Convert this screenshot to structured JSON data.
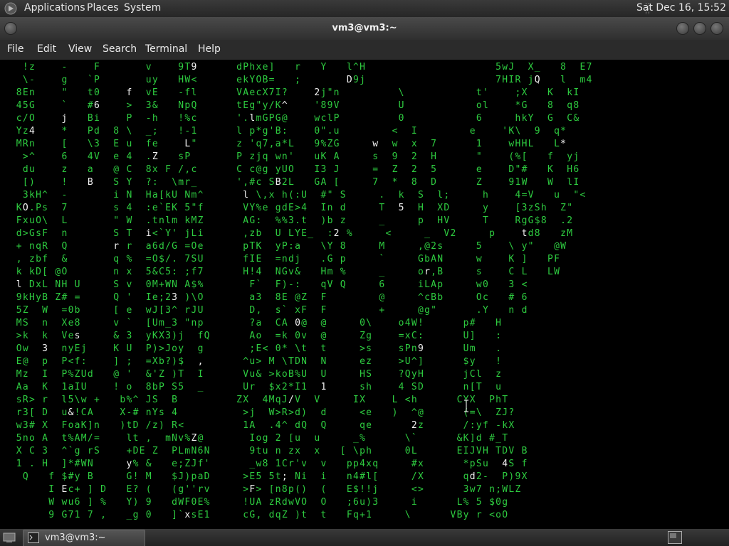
{
  "top_panel": {
    "menus": [
      "Applications",
      "Places",
      "System"
    ],
    "clock": "Sat Dec 16, 15:52"
  },
  "window": {
    "title": "vm3@vm3:~",
    "menu": [
      "File",
      "Edit",
      "View",
      "Search",
      "Terminal",
      "Help"
    ]
  },
  "taskbar": {
    "task_label": "vm3@vm3:~"
  },
  "terminal": {
    "rain_color": "#2ecc40",
    "bright_color": "#f2f2f2",
    "rows": [
      "   !z    -    F       v    9T9      dPhxe]   r   Y   l^H                    5wJ  X_   8  E7  ",
      "   \\-    g   `P       uy   HW<      ekYOB=   ;       D9j                    7HIR jQ   l  m4  ",
      "  8En    \"   t0    f  vE   -fl      VAecX7I?    2j\"n         \\           t'    ;X   K  kI  ",
      "  45G    `   #6    >  3&   NpQ      tEg\"y/K^    '89V         U           ol    *G   8  q8  ",
      "  c/O    j   Bi    P  -h   !%c      '.lmGPG@    wclP         0           6     hkY  G  C&  ",
      "  Yz4    *   Pd  8 \\  _;   !-1      l p*g'B:    0\".u        <  I        e    'K\\  9  q*  ",
      "  MRn    [   \\3  E u  fe    L\"      z 'q7,a*L   9%ZG     w  w  x  7      1    wHHL   L*  ",
      "   >^    6   4V  e 4  .Z   sP       P zjq wn'   uK A     s  9  2  H      \"    (%[   f  yj ",
      "   du    z   a   @ C  8x F /,c      C c@g yUO   I3 J     =  Z  2  5      e    D\"#   K  H6 ",
      "   [)    !   B   S Y  ?:  \\mr_      ',#c SB2L   GA [     7  *  8  D      Z    91W   W  lI ",
      "   3kH^  -       i N  Ha[kU Nm^      l \\,x h(:U  #\" S     .  k  S  l;     h    4=V   u  \"< ",
      "  KO.Ps  7       s 4  :e`EK 5\"f      VY%e gdE>4  In d     T  5  H  XD     y    [3zSh  Z\" ",
      "  FxuO\\  L       \" W  .tnlm kMZ      AG:  %%3.t  )b z     _     p  HV     T    RgG$8  .2  ",
      "  d>GsF  n       S T  i<`Y' jLi      ,zb  U LYE_  :2 %     <     _  V2     p    td8   zM  ",
      "  + nqR  Q       r r  a6d/G =Oe      pTK  yP:a   \\Y 8     M     ,@2s     5    \\ y\"   @W  ",
      "  , zbf  &       q %  =O$/. 7SU      fIE  =ndj   .G p     `     GbAN     w    K ]   PF  ",
      "  k kD[ @O       n x  5&C5: ;f7      H!4  NGv&   Hm %     _     or,B     s    C L   LW  ",
      "  l DxL NH U     S v  0M+WN A$%       F`  F)-:   qV Q     6     iLAp     w0   3 <   ",
      "  9kHyB Z# =     Q '  Ie;23 )\\O       a3  8E @Z  F        @     ^cBb     Oc   # 6   ",
      "  5Z  W  =0b     [ e  wJ[3^ rJU       D,  s` xF  F        +     @g\"      .Y   n d   ",
      "  MS  n  Xe8     v `  [Um_3 \"np       ?a  CA 0@  @     0\\    o4W!      p#   H     ",
      "  >k  k  Ves     & 3  yKX3)j  fQ      Ao  =k 0v  @     Zg    =xC:      U]   :     ",
      "  Ow  3  nyEj    K U  P)>Joy  g       ;E< 0* \\t  t     >s    sPn9      Um   .     ",
      "  E@  p  P<f:    ] ;  =Xb?)$  ,      ^u> M \\TDN  N     ez    >U^]      $y   !     ",
      "  Mz  I  P%ZUd   @ '  &'Z )T  I      Vu& >koB%U  U     HS    ?QyH      jCl  z     ",
      "  Aa  K  1aIU    ! o  8bP S5  _      Ur  $x2*I1  1     sh    4 SD      n[T  u     ",
      "  sR> r  l5\\w +   b%^ JS  B         ZX  4MqJ/V  V     IX    L <h      CYX  PhT   ",
      "  r3[ D  u&!CA    X-# nYs 4          >j  W>R>d)  d     <e   )  ^@      (=\\  ZJ?   ",
      "  w3# X  FoaK]n   )tD /z) R<         1A  .4^ dQ  Q     qe      2z      /:yf -kX   ",
      "  5no A  t%AM/=    lt ,  mNv%Z@       Iog 2 [u  u     _%      \\`      &K]d #_T   ",
      "  X C 3  ^`g rS    +DE Z  PLmN6N      9tu n zx  x   [ \\ph     0L      EIJVH TDV B ",
      "  1 . H  ]*#WN     y% &   e;ZJf'      _w8 1Cr'v  v   pp4xq     #x      *pSu  4S f ",
      "   Q   f $#y B     G! M   $J)paD     >E5 5t; Ni  i   n4#l[     /X      qd2-  P)9X ",
      "       I Ec+ ] D   E? (   (g''rv     >F> [n8p()  (   E$!!j     <>      3w7 n;WLZ ",
      "       W wu6 ] %   Y) 9   dWF0E%     !UA zRdwVO  O   ;6u)3     i      L% 5 $0g ",
      "       9 G71 7 ,   _g 0   ]`xsE1     cG, dqZ )t  t   Fq+1     \\      VBy r <oO "
    ]
  }
}
